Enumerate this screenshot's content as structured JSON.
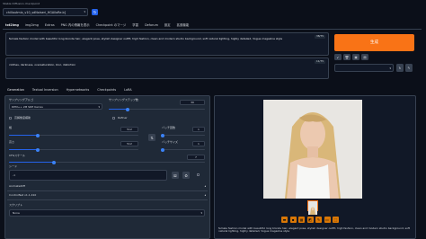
{
  "header": {
    "checkpoint_label": "Stable Diffusion checkpoint",
    "checkpoint_value": "chilloutmix_v10_sdNoiseri_HGAlloRe.b]"
  },
  "nav_tabs": [
    "txt2img",
    "img2img",
    "Extras",
    "PNG 内の情報を表示",
    "Checkpoint のマージ",
    "学習",
    "Deforum",
    "設定",
    "拡張機能"
  ],
  "prompt": {
    "text": "female fashion model with beautiful long blonde hair, elegant pose, stylish designer outfit, high fashion, clean and modern studio background, soft natural lighting, highly detailed, Vogue magazine style",
    "counter": "38/75"
  },
  "negative": {
    "text": "clothes, darkness, oversaturation, blur, distortion",
    "counter": "11/75"
  },
  "generate_label": "生成",
  "sub_tabs": [
    "Generation",
    "Textual Inversion",
    "Hypernetworks",
    "Checkpoints",
    "LoRA"
  ],
  "sampling": {
    "method_label": "サンプリングアルゴ",
    "method_value": "DPM++ 2M SDE Karras",
    "steps_label": "サンプリングステップ数",
    "steps_value": "30",
    "steps_fraction": 0.2
  },
  "checks": {
    "hires_label": "高解像度補助",
    "refiner_label": "Refiner"
  },
  "dims": {
    "width_label": "幅",
    "width_value": "512",
    "width_fraction": 0.22,
    "height_label": "高さ",
    "height_value": "512",
    "height_fraction": 0.22,
    "batch_count_label": "バッチ回数",
    "batch_count_value": "1",
    "batch_size_label": "バッチサイズ",
    "batch_size_value": "1",
    "swap_icon": "swap-arrows-icon"
  },
  "cfg": {
    "label": "CFGスケール",
    "value": "7",
    "fraction": 0.23
  },
  "seed": {
    "label": "シード",
    "value": "-1"
  },
  "accordions": [
    "AnimateDiff",
    "ControlNet v1.1.410"
  ],
  "script": {
    "label": "スクリプト",
    "value": "None"
  },
  "output": {
    "caption": "female fashion model with beautiful long blonde hair, elegant pose, stylish designer outfit, high fashion, clean and modern studio background, soft natural lighting, highly detailed, Vogue magazine style"
  },
  "colors": {
    "accent": "#f97316",
    "slider": "#3b82f6",
    "background": "#0b0f19"
  }
}
